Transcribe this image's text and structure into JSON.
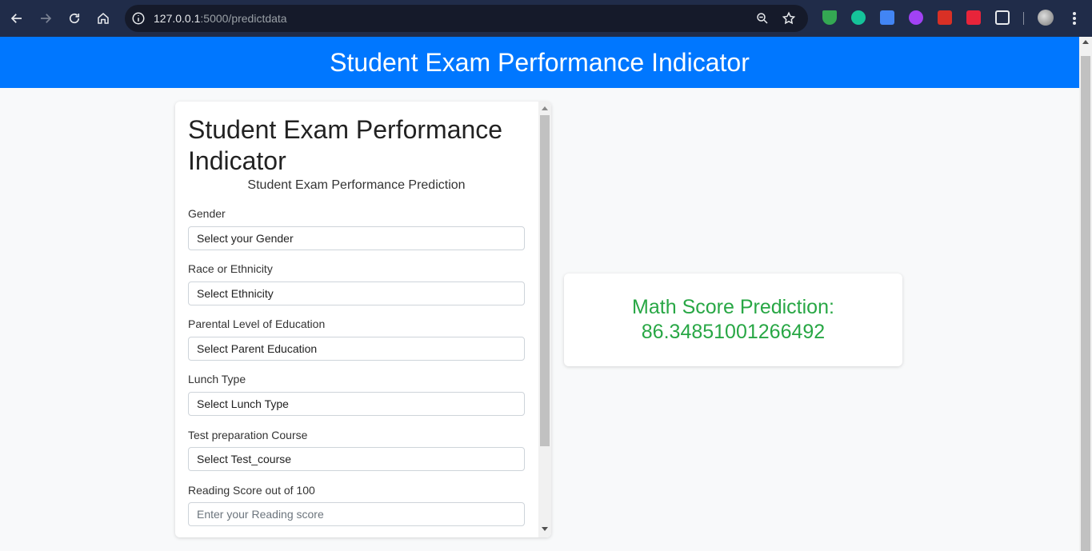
{
  "browser": {
    "url_host": "127.0.0.1",
    "url_path": ":5000/predictdata"
  },
  "header": {
    "title": "Student Exam Performance Indicator"
  },
  "form": {
    "title": "Student Exam Performance Indicator",
    "subtitle": "Student Exam Performance Prediction",
    "fields": [
      {
        "label": "Gender",
        "value": "Select your Gender"
      },
      {
        "label": "Race or Ethnicity",
        "value": "Select Ethnicity"
      },
      {
        "label": "Parental Level of Education",
        "value": "Select Parent Education"
      },
      {
        "label": "Lunch Type",
        "value": "Select Lunch Type"
      },
      {
        "label": "Test preparation Course",
        "value": "Select Test_course"
      },
      {
        "label": "Reading Score out of 100",
        "placeholder": "Enter your Reading score"
      }
    ]
  },
  "result": {
    "label": "Math Score Prediction:",
    "value": "86.34851001266492"
  },
  "colors": {
    "header_bg": "#0077ff",
    "result_text": "#28a745"
  }
}
